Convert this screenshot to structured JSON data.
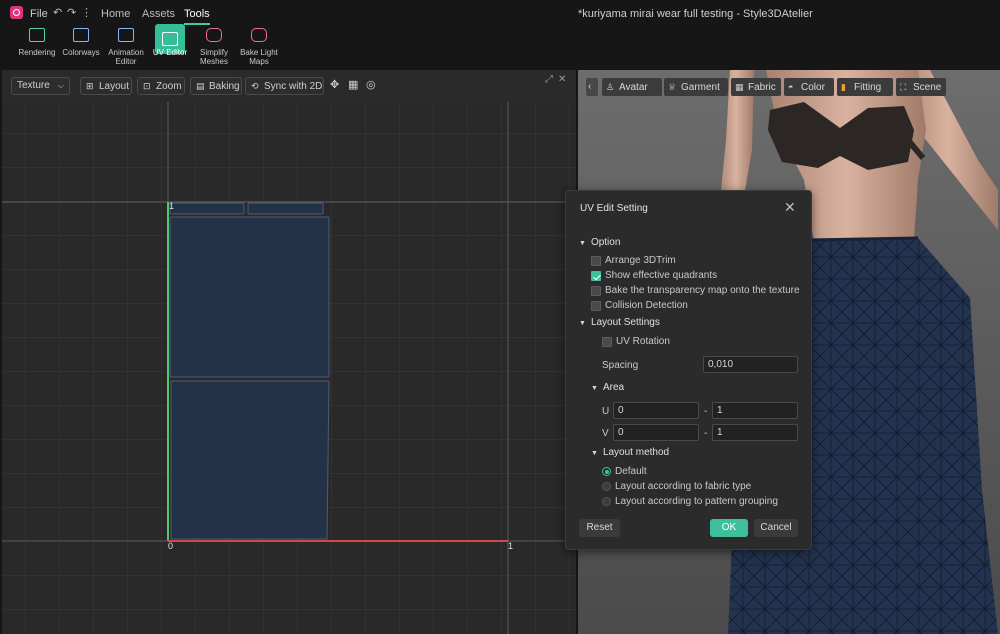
{
  "app": {
    "menu": {
      "file": "File"
    },
    "tabs": [
      {
        "label": "Home"
      },
      {
        "label": "Assets"
      },
      {
        "label": "Tools"
      }
    ],
    "window_title": "*kuriyama mirai wear full testing - Style3DAtelier",
    "accent_color": "#3ec9a7"
  },
  "ribbon": {
    "tools": [
      {
        "label": "Rendering",
        "icon": "rendering-icon"
      },
      {
        "label": "Colorways",
        "icon": "colorways-icon"
      },
      {
        "label": "Animation Editor",
        "icon": "animation-editor-icon"
      },
      {
        "label": "UV Editor",
        "icon": "uv-editor-icon",
        "active": true
      },
      {
        "label": "Simplify Meshes",
        "icon": "simplify-meshes-icon"
      },
      {
        "label": "Bake Light Maps",
        "icon": "bake-light-maps-icon"
      }
    ]
  },
  "uv_panel": {
    "mode_select": "Texture",
    "buttons": {
      "layout": "Layout",
      "zoom": "Zoom",
      "baking": "Baking",
      "sync": "Sync with 2D"
    },
    "axis_labels": {
      "origin": "0",
      "u_max": "1",
      "v_max": "1"
    }
  },
  "viewport": {
    "tabs": [
      {
        "label": "Avatar",
        "icon": "avatar-icon"
      },
      {
        "label": "Garment",
        "icon": "garment-icon"
      },
      {
        "label": "Fabric",
        "icon": "fabric-icon"
      },
      {
        "label": "Color",
        "icon": "color-icon"
      },
      {
        "label": "Fitting",
        "icon": "fitting-icon"
      },
      {
        "label": "Scene",
        "icon": "scene-icon"
      }
    ]
  },
  "dialog": {
    "title": "UV Edit Setting",
    "option": {
      "heading": "Option",
      "items": [
        {
          "label": "Arrange 3DTrim",
          "checked": false
        },
        {
          "label": "Show effective quadrants",
          "checked": true
        },
        {
          "label": "Bake the transparency map onto the texture",
          "checked": false
        },
        {
          "label": "Collision Detection",
          "checked": false
        }
      ]
    },
    "layout_settings": {
      "heading": "Layout Settings",
      "uv_rotation": {
        "label": "UV Rotation",
        "checked": false
      },
      "spacing": {
        "label": "Spacing",
        "value": "0,010"
      },
      "area": {
        "heading": "Area",
        "u": {
          "label": "U",
          "min": "0",
          "dash": "-",
          "max": "1"
        },
        "v": {
          "label": "V",
          "min": "0",
          "dash": "-",
          "max": "1"
        }
      },
      "method": {
        "heading": "Layout method",
        "options": [
          {
            "label": "Default",
            "selected": true
          },
          {
            "label": "Layout according to fabric type",
            "selected": false
          },
          {
            "label": "Layout according to pattern grouping",
            "selected": false
          }
        ]
      }
    },
    "buttons": {
      "reset": "Reset",
      "ok": "OK",
      "cancel": "Cancel"
    }
  }
}
